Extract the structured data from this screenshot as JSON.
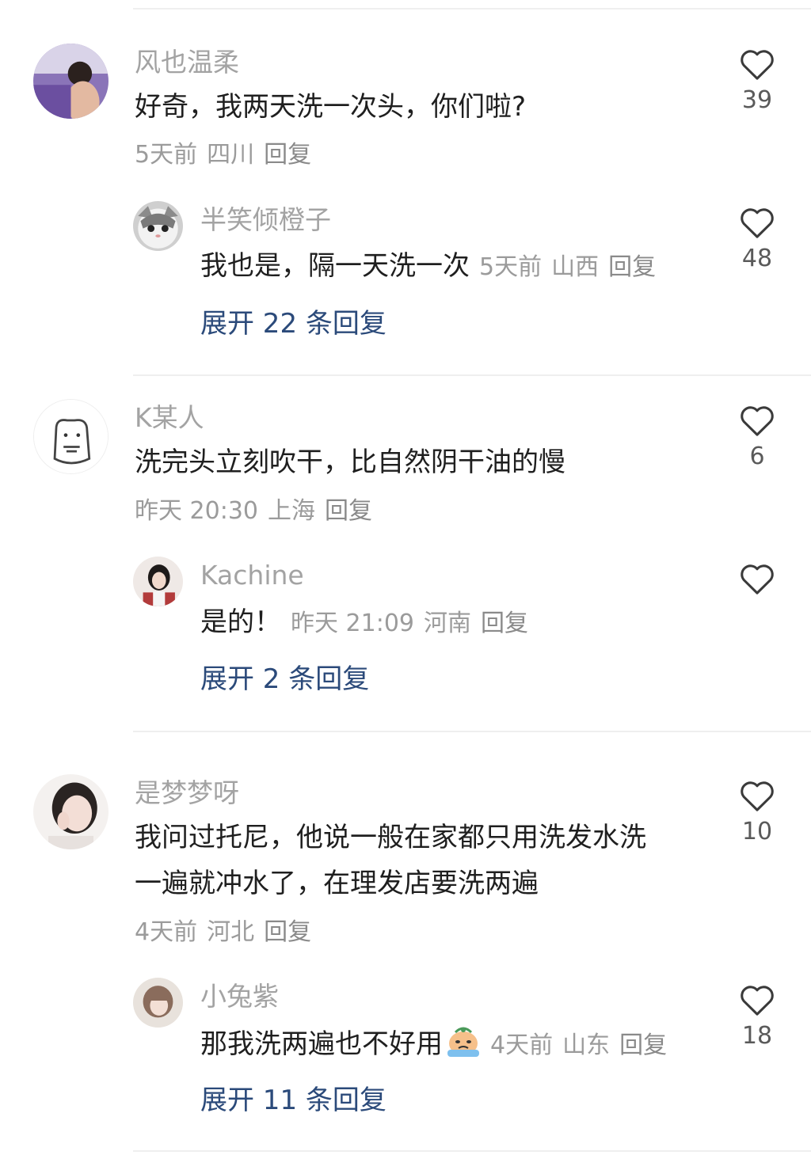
{
  "comments": [
    {
      "username": "风也温柔",
      "text": "好奇，我两天洗一次头，你们啦?",
      "time": "5天前",
      "location": "四川",
      "reply_label": "回复",
      "likes": "39",
      "reply": {
        "username": "半笑倾橙子",
        "text": "我也是，隔一天洗一次",
        "time": "5天前",
        "location": "山西",
        "reply_label": "回复",
        "likes": "48"
      },
      "expand_label": "展开 22 条回复"
    },
    {
      "username": "K某人",
      "text": "洗完头立刻吹干，比自然阴干油的慢",
      "time": "昨天 20:30",
      "location": "上海",
      "reply_label": "回复",
      "likes": "6",
      "reply": {
        "username": "Kachine",
        "text": "是的！",
        "time": "昨天 21:09",
        "location": "河南",
        "reply_label": "回复",
        "likes": ""
      },
      "expand_label": "展开 2 条回复"
    },
    {
      "username": "是梦梦呀",
      "text_line1": "我问过托尼，他说一般在家都只用洗发水洗",
      "text_line2": "一遍就冲水了，在理发店要洗两遍",
      "time": "4天前",
      "location": "河北",
      "reply_label": "回复",
      "likes": "10",
      "reply": {
        "username": "小兔紫",
        "text": "那我洗两遍也不好用",
        "emoji": "crying-emoji",
        "time": "4天前",
        "location": "山东",
        "reply_label": "回复",
        "likes": "18"
      },
      "expand_label": "展开 11 条回复"
    }
  ],
  "colors": {
    "username": "#a3a3a3",
    "meta": "#9b9b9b",
    "expand_link": "#2b4a7a",
    "divider": "#efefef"
  },
  "icons": {
    "like": "heart-outline-icon"
  }
}
